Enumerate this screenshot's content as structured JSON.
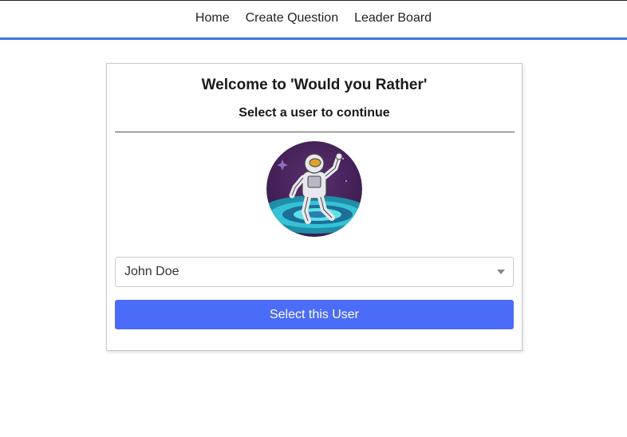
{
  "nav": {
    "items": [
      {
        "label": "Home"
      },
      {
        "label": "Create Question"
      },
      {
        "label": "Leader Board"
      }
    ]
  },
  "login": {
    "title": "Welcome to 'Would you Rather'",
    "subtitle": "Select a user to continue",
    "avatar_icon": "astronaut-avatar-icon",
    "selected_user": "John Doe",
    "button_label": "Select this User"
  },
  "colors": {
    "accent": "#4472e0",
    "button": "#4a6cf7"
  }
}
